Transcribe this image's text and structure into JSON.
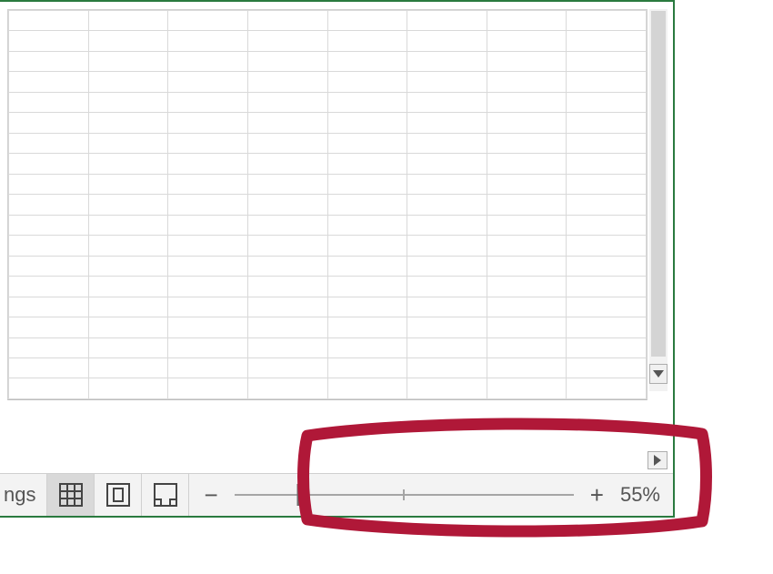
{
  "status": {
    "label_fragment": "ngs"
  },
  "zoom": {
    "minus": "−",
    "plus": "+",
    "percent": "55%"
  }
}
